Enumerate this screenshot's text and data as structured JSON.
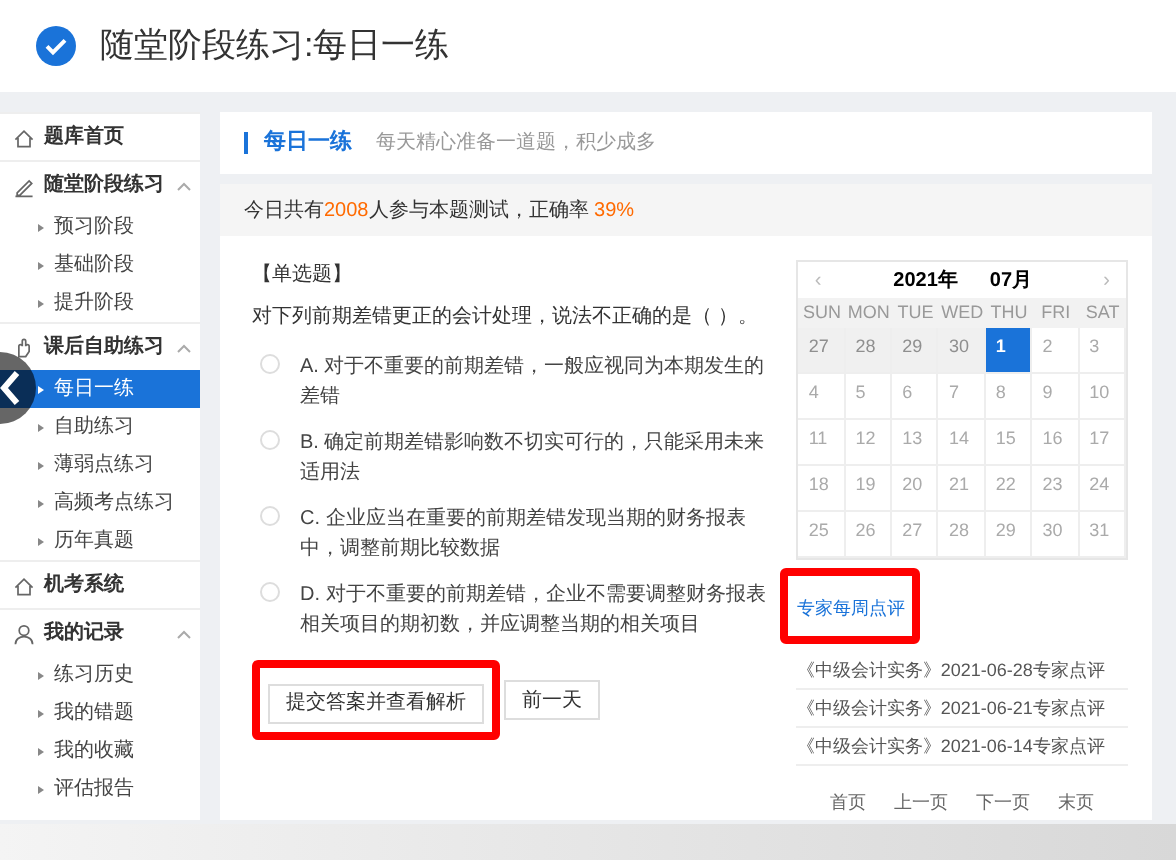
{
  "header": {
    "title": "随堂阶段练习:每日一练"
  },
  "sidebar": {
    "sections": [
      {
        "label": "题库首页"
      },
      {
        "label": "随堂阶段练习",
        "expanded": true,
        "children": [
          {
            "label": "预习阶段",
            "selected": false
          },
          {
            "label": "基础阶段",
            "selected": false
          },
          {
            "label": "提升阶段",
            "selected": false
          }
        ]
      },
      {
        "label": "课后自助练习",
        "expanded": true,
        "children": [
          {
            "label": "每日一练",
            "selected": true
          },
          {
            "label": "自助练习",
            "selected": false
          },
          {
            "label": "薄弱点练习",
            "selected": false
          },
          {
            "label": "高频考点练习",
            "selected": false
          },
          {
            "label": "历年真题",
            "selected": false
          }
        ]
      },
      {
        "label": "机考系统"
      },
      {
        "label": "我的记录",
        "expanded": true,
        "children": [
          {
            "label": "练习历史",
            "selected": false
          },
          {
            "label": "我的错题",
            "selected": false
          },
          {
            "label": "我的收藏",
            "selected": false
          },
          {
            "label": "评估报告",
            "selected": false
          }
        ]
      }
    ]
  },
  "panel_title": {
    "title": "每日一练",
    "subtitle": "每天精心准备一道题，积少成多"
  },
  "stats": {
    "prefix": "今日共有",
    "count": "2008",
    "middle": "人参与本题测试，正确率",
    "rate": "39%"
  },
  "question": {
    "type": "【单选题】",
    "text": "对下列前期差错更正的会计处理，说法不正确的是（   ）。",
    "options": [
      {
        "text": "A. 对于不重要的前期差错，一般应视同为本期发生的差错",
        "selected": false
      },
      {
        "text": "B. 确定前期差错影响数不切实可行的，只能采用未来适用法",
        "selected": false
      },
      {
        "text": "C. 企业应当在重要的前期差错发现当期的财务报表中，调整前期比较数据",
        "selected": false
      },
      {
        "text": "D. 对于不重要的前期差错，企业不需要调整财务报表相关项目的期初数，并应调整当期的相关项目",
        "selected": false
      }
    ]
  },
  "buttons": [
    "提交答案并查看解析",
    "前一天"
  ],
  "calendar": {
    "prev": "‹",
    "year": "2021年",
    "month": "07月",
    "next": "›",
    "weekdays": [
      "SUN",
      "MON",
      "TUE",
      "WED",
      "THU",
      "FRI",
      "SAT"
    ],
    "weeks": [
      [
        {
          "day": "27",
          "outside": true,
          "selected": false
        },
        {
          "day": "28",
          "outside": true,
          "selected": false
        },
        {
          "day": "29",
          "outside": true,
          "selected": false
        },
        {
          "day": "30",
          "outside": true,
          "selected": false
        },
        {
          "day": "1",
          "outside": false,
          "selected": true
        },
        {
          "day": "2",
          "outside": false,
          "selected": false
        },
        {
          "day": "3",
          "outside": false,
          "selected": false
        }
      ],
      [
        {
          "day": "4",
          "outside": false,
          "selected": false
        },
        {
          "day": "5",
          "outside": false,
          "selected": false
        },
        {
          "day": "6",
          "outside": false,
          "selected": false
        },
        {
          "day": "7",
          "outside": false,
          "selected": false
        },
        {
          "day": "8",
          "outside": false,
          "selected": false
        },
        {
          "day": "9",
          "outside": false,
          "selected": false
        },
        {
          "day": "10",
          "outside": false,
          "selected": false
        }
      ],
      [
        {
          "day": "11",
          "outside": false,
          "selected": false
        },
        {
          "day": "12",
          "outside": false,
          "selected": false
        },
        {
          "day": "13",
          "outside": false,
          "selected": false
        },
        {
          "day": "14",
          "outside": false,
          "selected": false
        },
        {
          "day": "15",
          "outside": false,
          "selected": false
        },
        {
          "day": "16",
          "outside": false,
          "selected": false
        },
        {
          "day": "17",
          "outside": false,
          "selected": false
        }
      ],
      [
        {
          "day": "18",
          "outside": false,
          "selected": false
        },
        {
          "day": "19",
          "outside": false,
          "selected": false
        },
        {
          "day": "20",
          "outside": false,
          "selected": false
        },
        {
          "day": "21",
          "outside": false,
          "selected": false
        },
        {
          "day": "22",
          "outside": false,
          "selected": false
        },
        {
          "day": "23",
          "outside": false,
          "selected": false
        },
        {
          "day": "24",
          "outside": false,
          "selected": false
        }
      ],
      [
        {
          "day": "25",
          "outside": false,
          "selected": false
        },
        {
          "day": "26",
          "outside": false,
          "selected": false
        },
        {
          "day": "27",
          "outside": false,
          "selected": false
        },
        {
          "day": "28",
          "outside": false,
          "selected": false
        },
        {
          "day": "29",
          "outside": false,
          "selected": false
        },
        {
          "day": "30",
          "outside": false,
          "selected": false
        },
        {
          "day": "31",
          "outside": false,
          "selected": false
        }
      ]
    ]
  },
  "reviews": {
    "title": "专家每周点评",
    "items": [
      "《中级会计实务》2021-06-28专家点评",
      "《中级会计实务》2021-06-21专家点评",
      "《中级会计实务》2021-06-14专家点评"
    ],
    "pager": [
      "首页",
      "上一页",
      "下一页",
      "末页"
    ]
  }
}
